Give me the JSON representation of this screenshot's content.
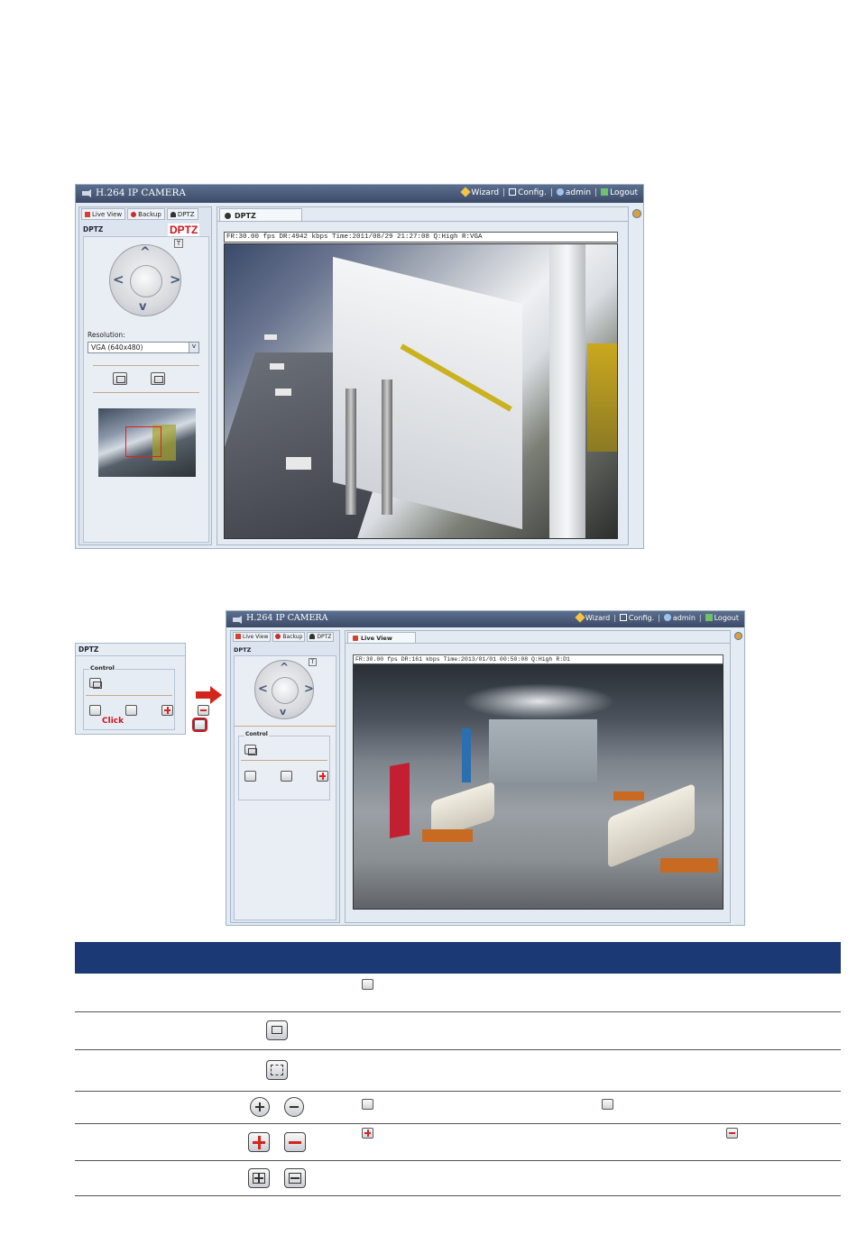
{
  "window1": {
    "title": "H.264 IP CAMERA",
    "nav": [
      "Wizard",
      "Config.",
      "admin",
      "Logout"
    ],
    "tabs": [
      "Live View",
      "Backup",
      "DPTZ"
    ],
    "panel_title": "DPTZ",
    "badge": "DPTZ",
    "resolution_label": "Resolution:",
    "resolution_value": "VGA (640x480)",
    "view_tab": "DPTZ",
    "status": "FR:30.00 fps  DR:4942 kbps Time:2011/08/29 21:27:08 Q:High R:VGA"
  },
  "inset": {
    "panel_title": "DPTZ",
    "group_label": "Control",
    "click_label": "Click"
  },
  "window2": {
    "title": "H.264 IP CAMERA",
    "nav": [
      "Wizard",
      "Config.",
      "admin",
      "Logout"
    ],
    "tabs": [
      "Live View",
      "Backup",
      "DPTZ"
    ],
    "panel_title": "DPTZ",
    "group_label": "Control",
    "view_tab": "Live View",
    "status": "FR:30.00 fps  DR:161 kbps Time:2013/01/01 00:50:08 Q:High R:D1"
  },
  "colors": {
    "table_header": "#1b3a75",
    "callout_red": "#d0121b",
    "arrow_red": "#d2261d"
  },
  "icons": [
    "snapshot-icon",
    "full-screen-icon",
    "zoom-in-icon",
    "zoom-out-icon",
    "plus-icon",
    "minus-icon",
    "expand-icon",
    "shrink-icon"
  ]
}
